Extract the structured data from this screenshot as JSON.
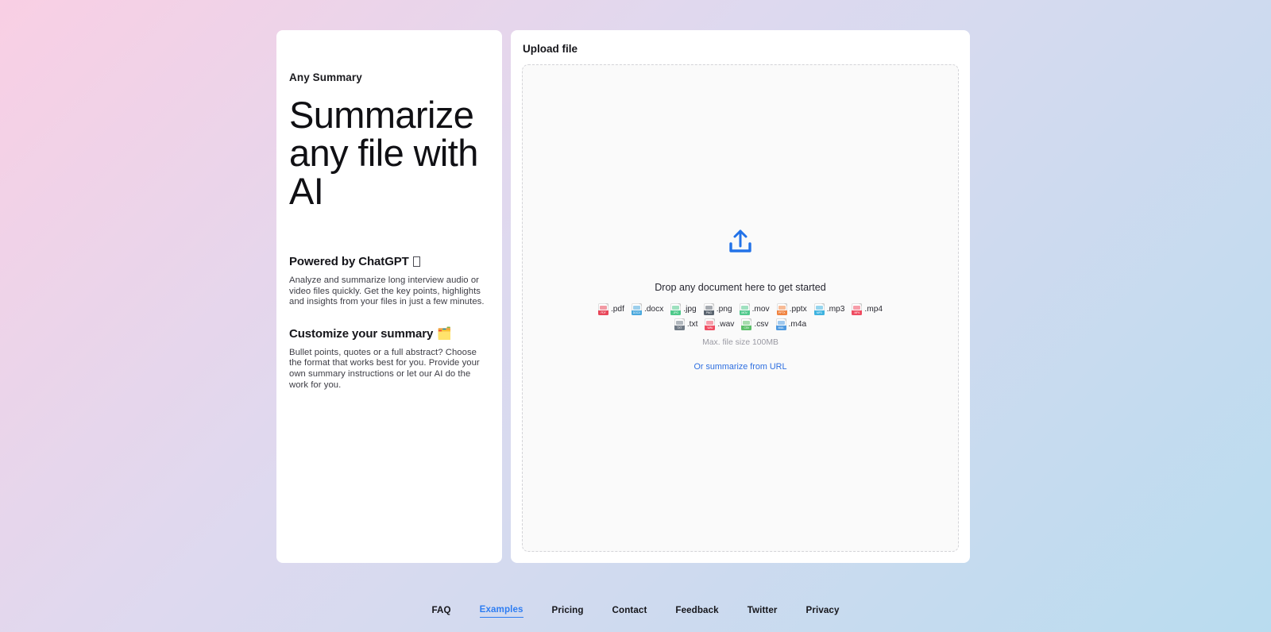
{
  "background": {
    "gradient_from": "#f9cfe4",
    "gradient_mid": "#ded9ef",
    "gradient_to": "#b9dcef"
  },
  "info_card": {
    "brand": "Any Summary",
    "hero_title": "Summarize any file with AI",
    "features": [
      {
        "heading": "Powered by ChatGPT",
        "icon_name": "missing-glyph-box",
        "body": "Analyze and summarize long interview audio or video files quickly. Get the key points, highlights and insights from your files in just a few minutes."
      },
      {
        "heading": "Customize your summary",
        "icon_name": "card-index-dividers-emoji",
        "emoji": "🗂️",
        "body": "Bullet points, quotes or a full abstract? Choose the format that works best for you. Provide your own summary instructions or let our AI do the work for you."
      }
    ]
  },
  "upload_card": {
    "title": "Upload file",
    "upload_icon": "upload-arrow-tray-icon",
    "headline": "Drop any document here to get started",
    "filetypes": [
      {
        "label": ".pdf",
        "tag": "PDF",
        "color": "#e8475a"
      },
      {
        "label": ".docx",
        "tag": "DOCX",
        "color": "#4aa8dd"
      },
      {
        "label": ".jpg",
        "tag": "JPG",
        "color": "#4fc98a"
      },
      {
        "label": ".png",
        "tag": "PNG",
        "color": "#5b6570"
      },
      {
        "label": ".mov",
        "tag": "MOV",
        "color": "#52c98d"
      },
      {
        "label": ".pptx",
        "tag": "PPTX",
        "color": "#f08340"
      },
      {
        "label": ".mp3",
        "tag": "MP3",
        "color": "#3fb3e0"
      },
      {
        "label": ".mp4",
        "tag": "MP4",
        "color": "#ef4d62"
      },
      {
        "label": ".txt",
        "tag": "TXT",
        "color": "#707a85"
      },
      {
        "label": ".wav",
        "tag": "WAV",
        "color": "#ef4d62"
      },
      {
        "label": ".csv",
        "tag": "CSV",
        "color": "#5cc06a"
      },
      {
        "label": ".m4a",
        "tag": "M4A",
        "color": "#4f9ae0"
      }
    ],
    "max_size": "Max. file size 100MB",
    "url_link": "Or summarize from URL",
    "accent_color": "#2e6fe0"
  },
  "footer": {
    "active_color": "#2e7df2",
    "links": [
      {
        "label": "FAQ",
        "active": false
      },
      {
        "label": "Examples",
        "active": true
      },
      {
        "label": "Pricing",
        "active": false
      },
      {
        "label": "Contact",
        "active": false
      },
      {
        "label": "Feedback",
        "active": false
      },
      {
        "label": "Twitter",
        "active": false
      },
      {
        "label": "Privacy",
        "active": false
      }
    ]
  }
}
